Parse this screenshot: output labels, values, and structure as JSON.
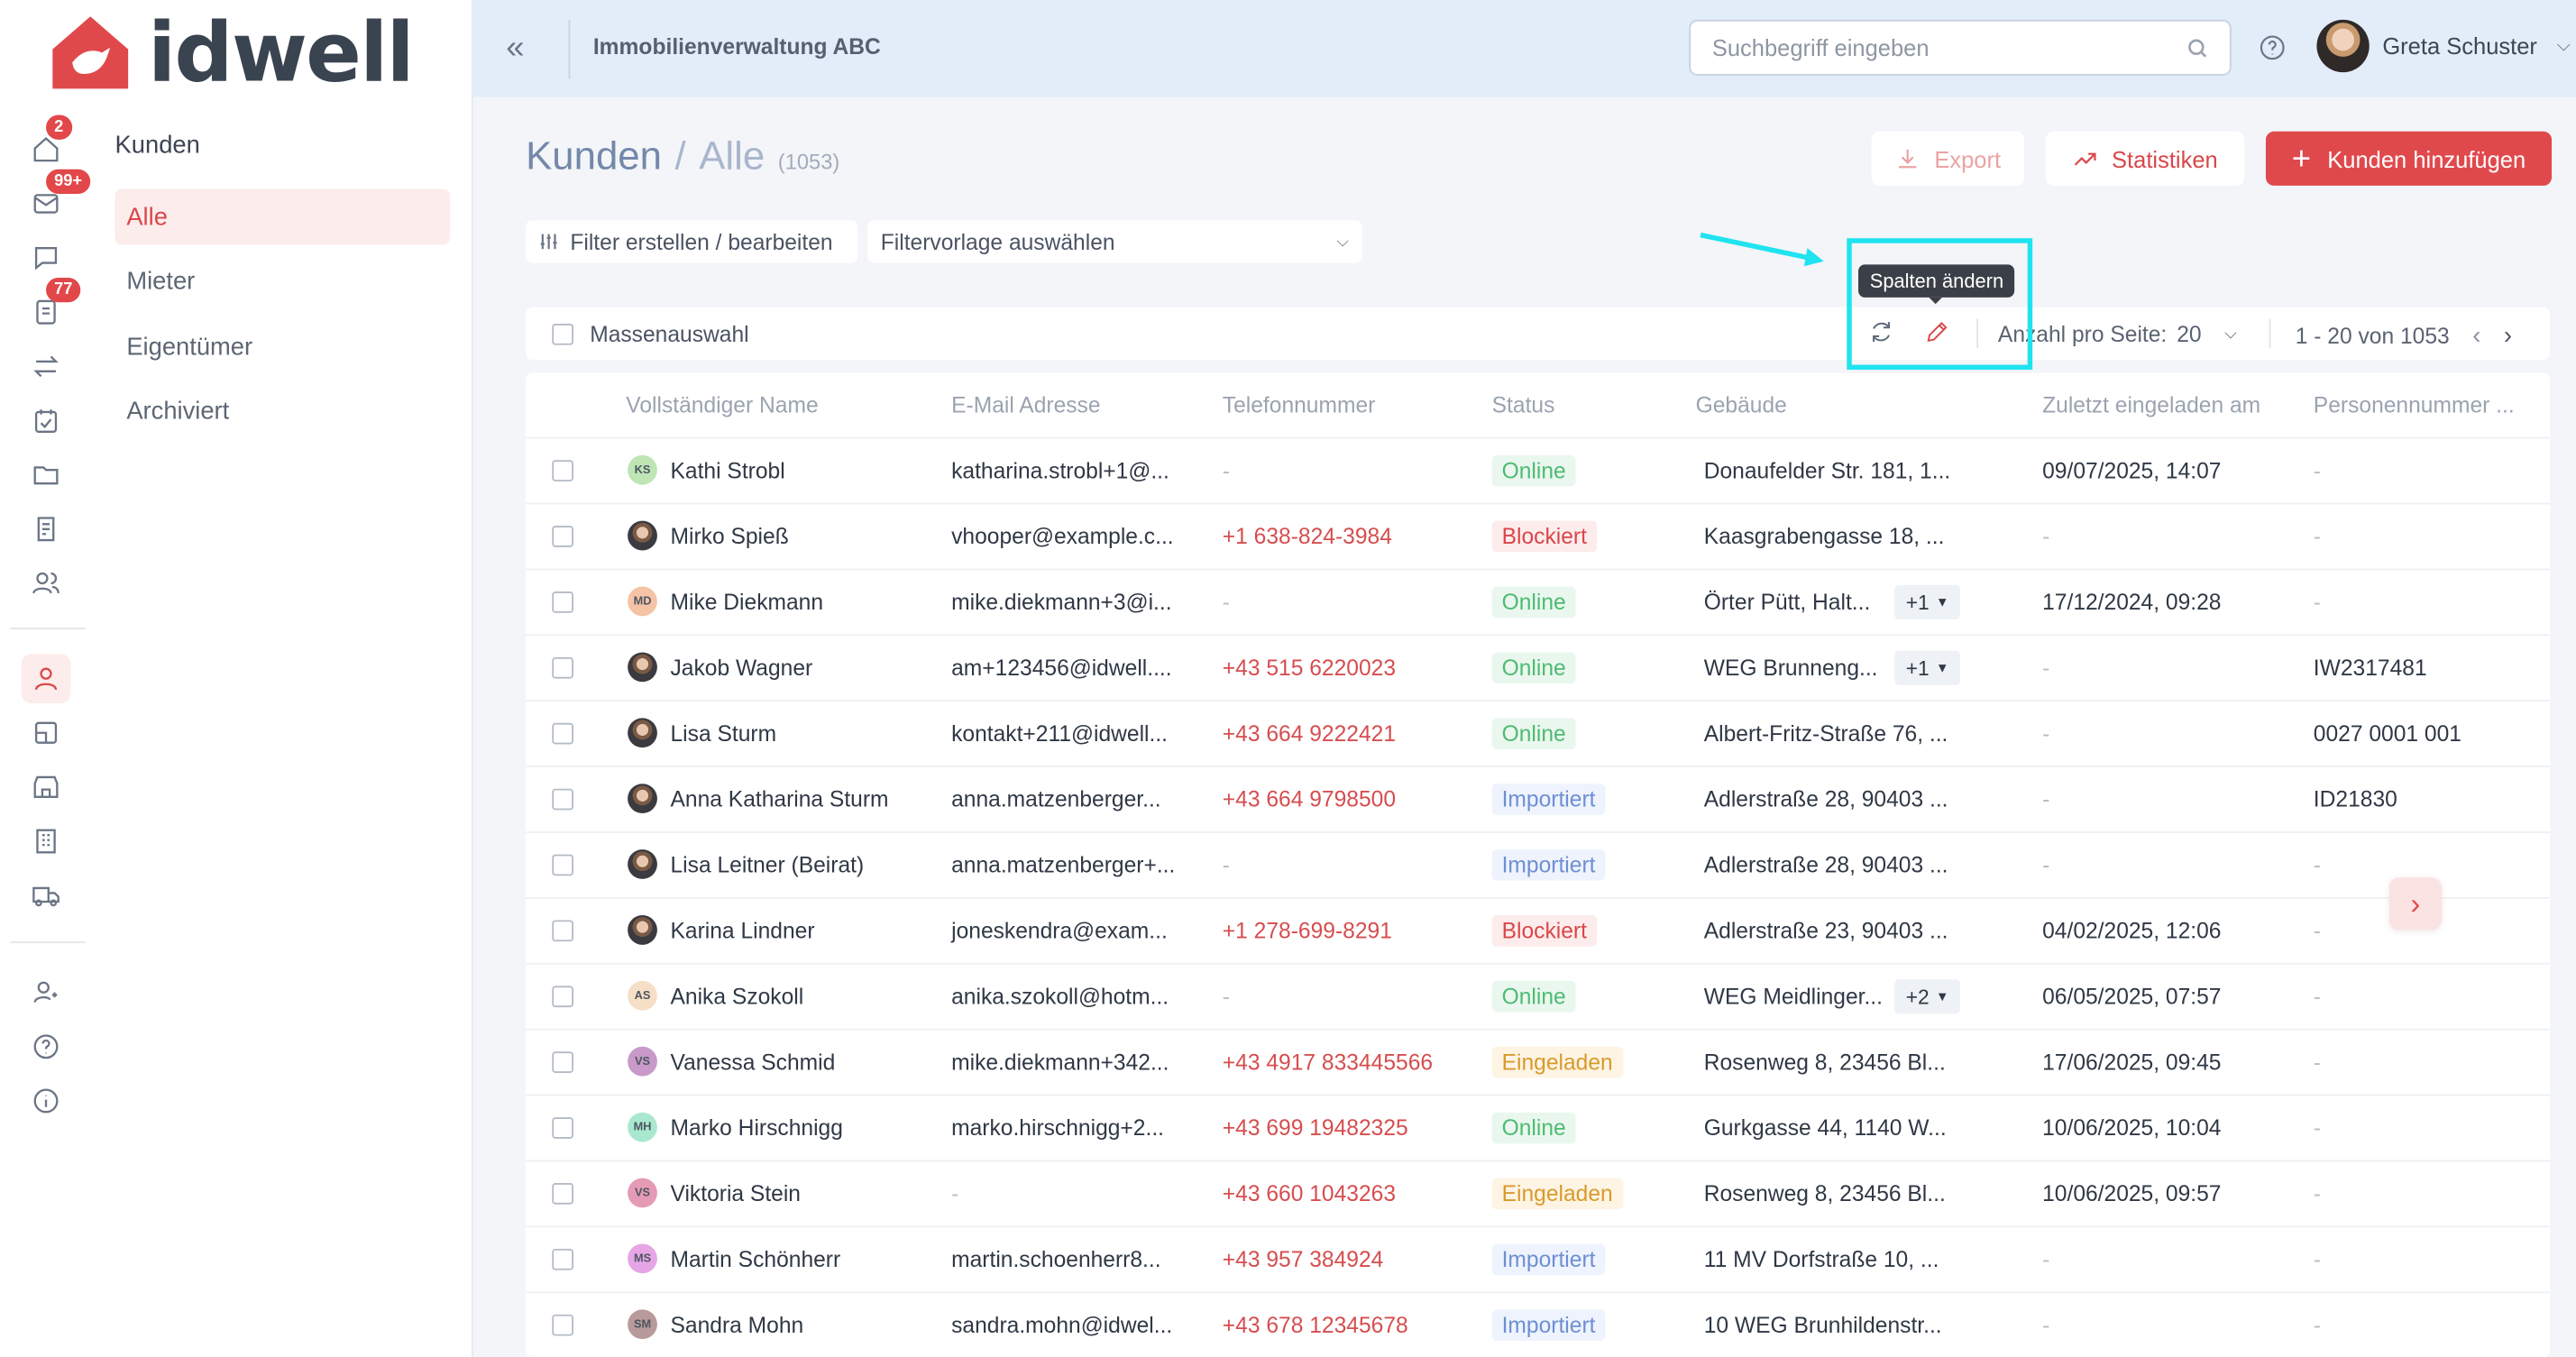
{
  "brand": {
    "name": "idwell",
    "color": "#e0494c"
  },
  "header": {
    "app_title": "Immobilienverwaltung ABC",
    "search_placeholder": "Suchbegriff eingeben",
    "user_name": "Greta Schuster"
  },
  "rail": {
    "badges": {
      "home": "2",
      "mail": "99+",
      "docs": "77"
    }
  },
  "subnav": {
    "title": "Kunden",
    "items": [
      {
        "label": "Alle",
        "active": true
      },
      {
        "label": "Mieter"
      },
      {
        "label": "Eigentümer"
      },
      {
        "label": "Archiviert"
      }
    ]
  },
  "page": {
    "breadcrumb_root": "Kunden",
    "breadcrumb_sep": "/",
    "breadcrumb_current": "Alle",
    "count": "(1053)",
    "export_label": "Export",
    "stats_label": "Statistiken",
    "add_label": "Kunden hinzufügen",
    "filter_button": "Filter erstellen / bearbeiten",
    "filter_select": "Filtervorlage auswählen"
  },
  "toolbar": {
    "mass_select": "Massenauswahl",
    "tooltip": "Spalten ändern",
    "per_page_label": "Anzahl pro Seite:",
    "per_page_value": "20",
    "pagination": "1 - 20 von 1053"
  },
  "table": {
    "columns": [
      "Vollständiger Name",
      "E-Mail Adresse",
      "Telefonnummer",
      "Status",
      "Gebäude",
      "Zuletzt eingeladen am",
      "Personennummer ..."
    ],
    "rows": [
      {
        "initials": "KS",
        "avatar_color": "#bfe5b5",
        "name": "Kathi Strobl",
        "email": "katharina.strobl+1@...",
        "phone": "-",
        "status": "Online",
        "building": "Donaufelder Str. 181, 1...",
        "extra": "",
        "invited": "09/07/2025, 14:07",
        "pnr": "-"
      },
      {
        "initials": "",
        "avatar_color": "photo",
        "name": "Mirko Spieß",
        "email": "vhooper@example.c...",
        "phone": "+1 638-824-3984",
        "status": "Blockiert",
        "building": "Kaasgrabengasse 18, ...",
        "extra": "",
        "invited": "-",
        "pnr": "-"
      },
      {
        "initials": "MD",
        "avatar_color": "#f5c3a5",
        "name": "Mike Diekmann",
        "email": "mike.diekmann+3@i...",
        "phone": "-",
        "status": "Online",
        "building": "Örter Pütt, Halt...",
        "extra": "+1",
        "invited": "17/12/2024, 09:28",
        "pnr": "-"
      },
      {
        "initials": "",
        "avatar_color": "photo",
        "name": "Jakob Wagner",
        "email": "am+123456@idwell....",
        "phone": "+43 515 6220023",
        "status": "Online",
        "building": "WEG Brunneng...",
        "extra": "+1",
        "invited": "-",
        "pnr": "IW2317481"
      },
      {
        "initials": "",
        "avatar_color": "photo",
        "name": "Lisa Sturm",
        "email": "kontakt+211@idwell...",
        "phone": "+43 664 9222421",
        "status": "Online",
        "building": "Albert-Fritz-Straße 76, ...",
        "extra": "",
        "invited": "-",
        "pnr": "0027 0001 001"
      },
      {
        "initials": "",
        "avatar_color": "photo",
        "name": "Anna Katharina Sturm",
        "email": "anna.matzenberger...",
        "phone": "+43 664 9798500",
        "status": "Importiert",
        "building": "Adlerstraße 28, 90403 ...",
        "extra": "",
        "invited": "-",
        "pnr": "ID21830"
      },
      {
        "initials": "",
        "avatar_color": "photo",
        "name": "Lisa Leitner (Beirat)",
        "email": "anna.matzenberger+...",
        "phone": "-",
        "status": "Importiert",
        "building": "Adlerstraße 28, 90403 ...",
        "extra": "",
        "invited": "-",
        "pnr": "-"
      },
      {
        "initials": "",
        "avatar_color": "photo",
        "name": "Karina Lindner",
        "email": "joneskendra@exam...",
        "phone": "+1 278-699-8291",
        "status": "Blockiert",
        "building": "Adlerstraße 23, 90403 ...",
        "extra": "",
        "invited": "04/02/2025, 12:06",
        "pnr": "-"
      },
      {
        "initials": "AS",
        "avatar_color": "#f6dfc6",
        "name": "Anika Szokoll",
        "email": "anika.szokoll@hotm...",
        "phone": "-",
        "status": "Online",
        "building": "WEG Meidlinger...",
        "extra": "+2",
        "invited": "06/05/2025, 07:57",
        "pnr": "-"
      },
      {
        "initials": "VS",
        "avatar_color": "#c79ac9",
        "name": "Vanessa Schmid",
        "email": "mike.diekmann+342...",
        "phone": "+43 4917 833445566",
        "status": "Eingeladen",
        "building": "Rosenweg 8, 23456 Bl...",
        "extra": "",
        "invited": "17/06/2025, 09:45",
        "pnr": "-"
      },
      {
        "initials": "MH",
        "avatar_color": "#a9e8cf",
        "name": "Marko Hirschnigg",
        "email": "marko.hirschnigg+2...",
        "phone": "+43 699 19482325",
        "status": "Online",
        "building": "Gurkgasse 44, 1140 W...",
        "extra": "",
        "invited": "10/06/2025, 10:04",
        "pnr": "-"
      },
      {
        "initials": "VS",
        "avatar_color": "#e59ab5",
        "name": "Viktoria Stein",
        "email": "-",
        "phone": "+43 660 1043263",
        "status": "Eingeladen",
        "building": "Rosenweg 8, 23456 Bl...",
        "extra": "",
        "invited": "10/06/2025, 09:57",
        "pnr": "-"
      },
      {
        "initials": "MS",
        "avatar_color": "#e6a6e6",
        "name": "Martin Schönherr",
        "email": "martin.schoenherr8...",
        "phone": "+43 957 384924",
        "status": "Importiert",
        "building": "11 MV Dorfstraße 10, ...",
        "extra": "",
        "invited": "-",
        "pnr": "-"
      },
      {
        "initials": "SM",
        "avatar_color": "#b99a9a",
        "name": "Sandra Mohn",
        "email": "sandra.mohn@idwel...",
        "phone": "+43 678 12345678",
        "status": "Importiert",
        "building": "10 WEG Brunhildenstr...",
        "extra": "",
        "invited": "-",
        "pnr": "-"
      }
    ]
  }
}
